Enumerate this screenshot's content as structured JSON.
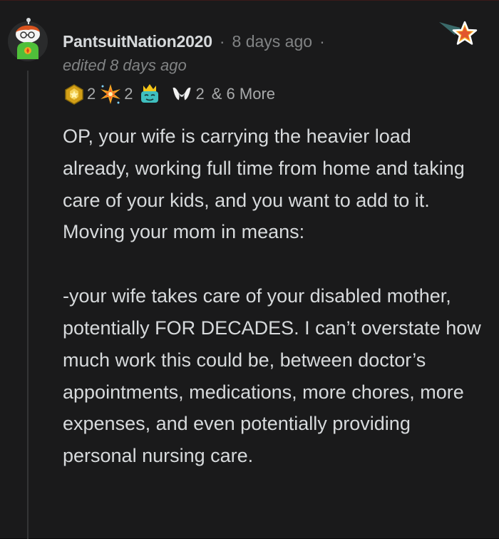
{
  "comment": {
    "username": "PantsuitNation2020",
    "separator": "·",
    "timestamp": "8 days ago",
    "edited": "edited 8 days ago",
    "awards": [
      {
        "icon": "gold-crown-award-icon",
        "count": "2"
      },
      {
        "icon": "sparkle-burst-award-icon",
        "count": "2"
      },
      {
        "icon": "crowned-face-award-icon",
        "count": ""
      },
      {
        "icon": "bunny-ears-award-icon",
        "count": "2"
      }
    ],
    "more_awards": "& 6 More",
    "paragraphs": [
      "OP, your wife is carrying the heavier load already, working full time from home and taking care of your kids, and you want to add to it. Moving your mom in means:",
      "-your wife takes care of your disabled mother, potentially FOR DECADES. I can’t overstate how much work this could be, between doctor’s appointments, medications, more chores, more expenses, and even potentially providing personal nursing care."
    ]
  },
  "colors": {
    "background": "#1a1a1b",
    "text": "#d7dadc",
    "muted": "#818384",
    "thread_line": "#343536"
  }
}
